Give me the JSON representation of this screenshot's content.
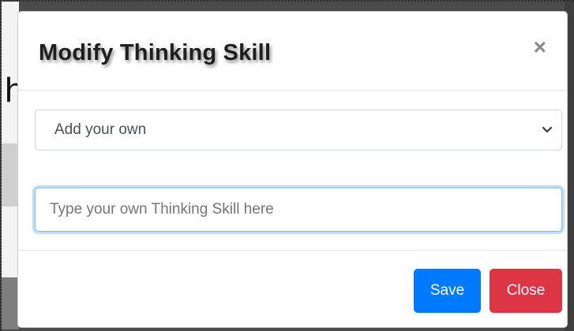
{
  "modal": {
    "title": "Modify Thinking Skill",
    "close_icon": "×"
  },
  "form": {
    "select": {
      "selected": "Add your own"
    },
    "input": {
      "placeholder": "Type your own Thinking Skill here",
      "value": ""
    }
  },
  "footer": {
    "save_label": "Save",
    "close_label": "Close"
  },
  "colors": {
    "primary": "#007bff",
    "danger": "#dc3545"
  }
}
